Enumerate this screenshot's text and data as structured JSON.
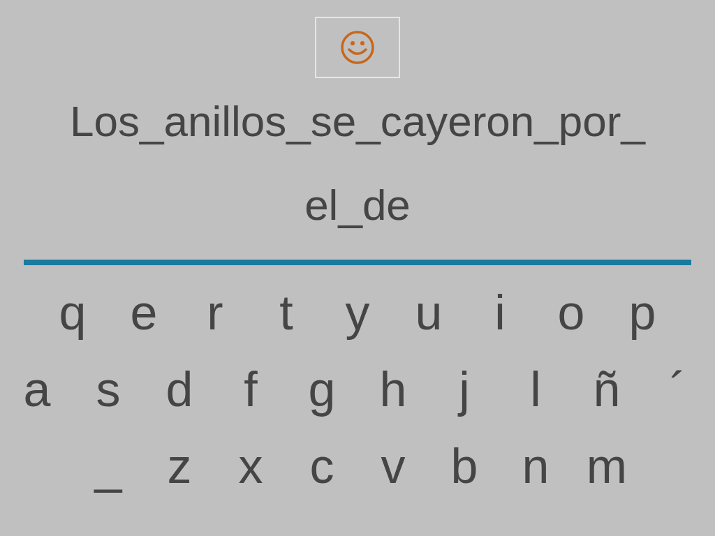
{
  "prompt_lines": [
    "Los_anillos_se_cayeron_por_",
    "el_de"
  ],
  "keyboard": {
    "rows": [
      [
        "q",
        "e",
        "r",
        "t",
        "y",
        "u",
        "i",
        "o",
        "p"
      ],
      [
        "a",
        "s",
        "d",
        "f",
        "g",
        "h",
        "j",
        "l",
        "ñ",
        "´"
      ],
      [
        "_",
        "z",
        "x",
        "c",
        "v",
        "b",
        "n",
        "m"
      ]
    ]
  }
}
